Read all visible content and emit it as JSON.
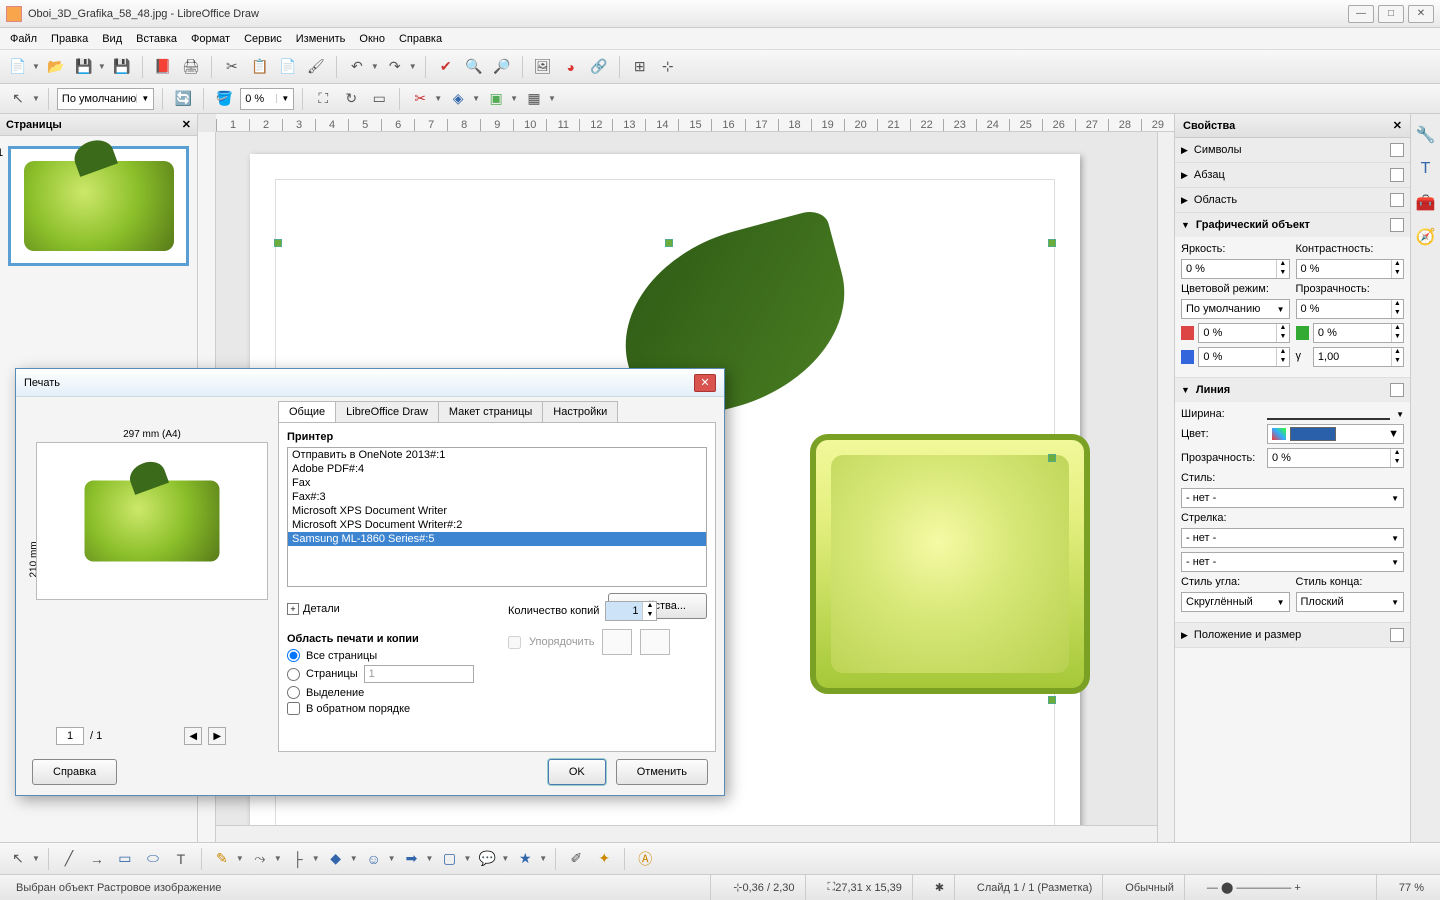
{
  "title": "Oboi_3D_Grafika_58_48.jpg - LibreOffice Draw",
  "menu": [
    "Файл",
    "Правка",
    "Вид",
    "Вставка",
    "Формат",
    "Сервис",
    "Изменить",
    "Окно",
    "Справка"
  ],
  "toolbar2": {
    "style": "По умолчанию",
    "zoom_val": "0 %"
  },
  "pages_panel": {
    "title": "Страницы",
    "pagenum": "1"
  },
  "ruler_marks": [
    "1",
    "2",
    "3",
    "4",
    "5",
    "6",
    "7",
    "8",
    "9",
    "10",
    "11",
    "12",
    "13",
    "14",
    "15",
    "16",
    "17",
    "18",
    "19",
    "20",
    "21",
    "22",
    "23",
    "24",
    "25",
    "26",
    "27",
    "28",
    "29"
  ],
  "properties": {
    "title": "Свойства",
    "sections": {
      "symbols": "Символы",
      "paragraph": "Абзац",
      "area": "Область",
      "graphic": "Графический объект",
      "line": "Линия",
      "possize": "Положение и размер"
    },
    "graphic": {
      "brightness_lbl": "Яркость:",
      "contrast_lbl": "Контрастность:",
      "brightness": "0 %",
      "contrast": "0 %",
      "colormode_lbl": "Цветовой режим:",
      "transp_lbl": "Прозрачность:",
      "colormode": "По умолчанию",
      "transp": "0 %",
      "r": "0 %",
      "g": "0 %",
      "b": "0 %",
      "gamma": "1,00"
    },
    "line": {
      "width_lbl": "Ширина:",
      "color_lbl": "Цвет:",
      "transp_lbl": "Прозрачность:",
      "transp": "0 %",
      "style_lbl": "Стиль:",
      "style": "- нет -",
      "arrow_lbl": "Стрелка:",
      "arrow1": "- нет -",
      "arrow2": "- нет -",
      "corner_lbl": "Стиль угла:",
      "end_lbl": "Стиль конца:",
      "corner": "Скруглённый",
      "end": "Плоский"
    }
  },
  "dialog": {
    "title": "Печать",
    "tabs": [
      "Общие",
      "LibreOffice Draw",
      "Макет страницы",
      "Настройки"
    ],
    "preview_top": "297 mm (A4)",
    "preview_side": "210 mm",
    "page_cur": "1",
    "page_total": "/ 1",
    "printer_grp": "Принтер",
    "printers": [
      "Отправить в OneNote 2013#:1",
      "Adobe PDF#:4",
      "Fax",
      "Fax#:3",
      "Microsoft XPS Document Writer",
      "Microsoft XPS Document Writer#:2",
      "Samsung ML-1860 Series#:5"
    ],
    "printer_selected": 6,
    "details": "Детали",
    "props_btn": "Свойства...",
    "range_grp": "Область печати и копии",
    "r_all": "Все страницы",
    "r_pages": "Страницы",
    "r_pages_val": "1",
    "r_sel": "Выделение",
    "r_reverse": "В обратном порядке",
    "copies_lbl": "Количество копий",
    "copies_val": "1",
    "collate": "Упорядочить",
    "help": "Справка",
    "ok": "OK",
    "cancel": "Отменить"
  },
  "status": {
    "selection": "Выбран объект Растровое изображение",
    "pos": "0,36 / 2,30",
    "size": "27,31 x 15,39",
    "slide": "Слайд 1 / 1 (Разметка)",
    "style": "Обычный",
    "zoom": "77 %"
  }
}
